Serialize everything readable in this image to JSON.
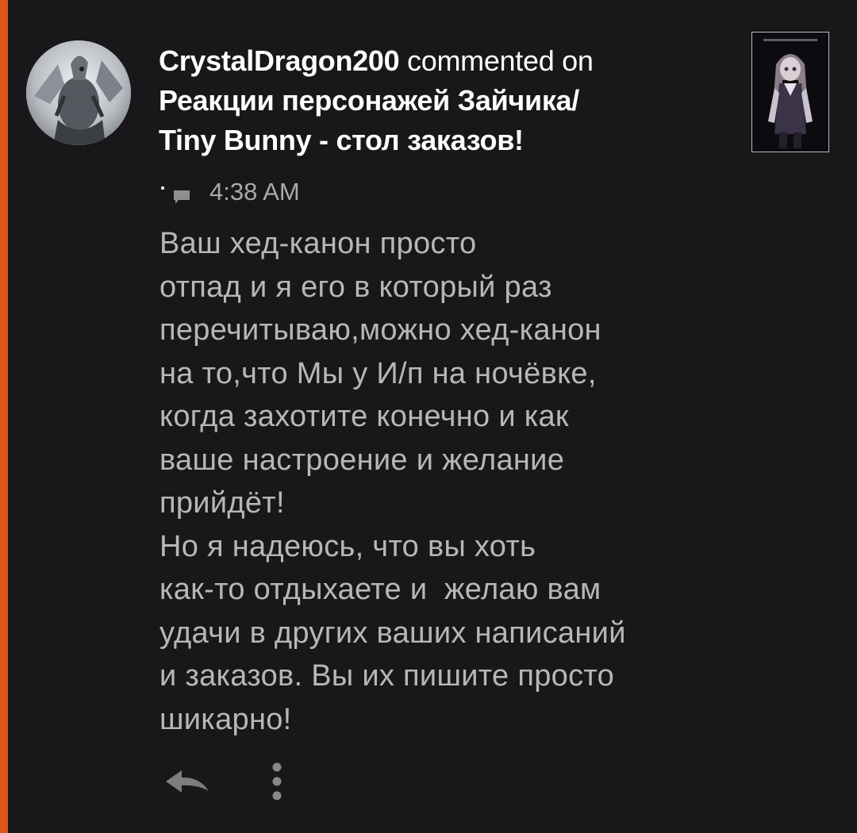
{
  "colors": {
    "background": "#1a171a",
    "accent_bar": "#e0551b",
    "header_text": "#ffffff",
    "meta_text": "#a9a9a9",
    "body_text": "#b8b6b8"
  },
  "notification": {
    "author": "CrystalDragon200",
    "verb": " commented on",
    "post_title_lines": [
      "Реакции персонажей Зайчика/",
      "Tiny Bunny - стол заказов!"
    ],
    "title_period": ".",
    "avatar_icon": "dragon-avatar-icon",
    "thumbnail_icon": "anime-girl-thumbnail-icon"
  },
  "meta": {
    "icon": "comment-icon",
    "time": "4:38 AM"
  },
  "comment": {
    "lines": [
      "Ваш хед-канон просто",
      "отпад и я его в который раз",
      "перечитываю,можно хед-канон",
      "на то,что Мы у И/п на ночёвке,",
      "когда захотите конечно и как",
      "ваше настроение и желание",
      "прийдёт!",
      "Но я надеюсь, что вы хоть",
      "как-то отдыхаете и  желаю вам",
      "удачи в других ваших написаний",
      "и заказов. Вы их пишите просто",
      "шикарно!"
    ]
  },
  "actions": {
    "reply_icon": "reply-icon",
    "more_icon": "more-vertical-icon"
  }
}
